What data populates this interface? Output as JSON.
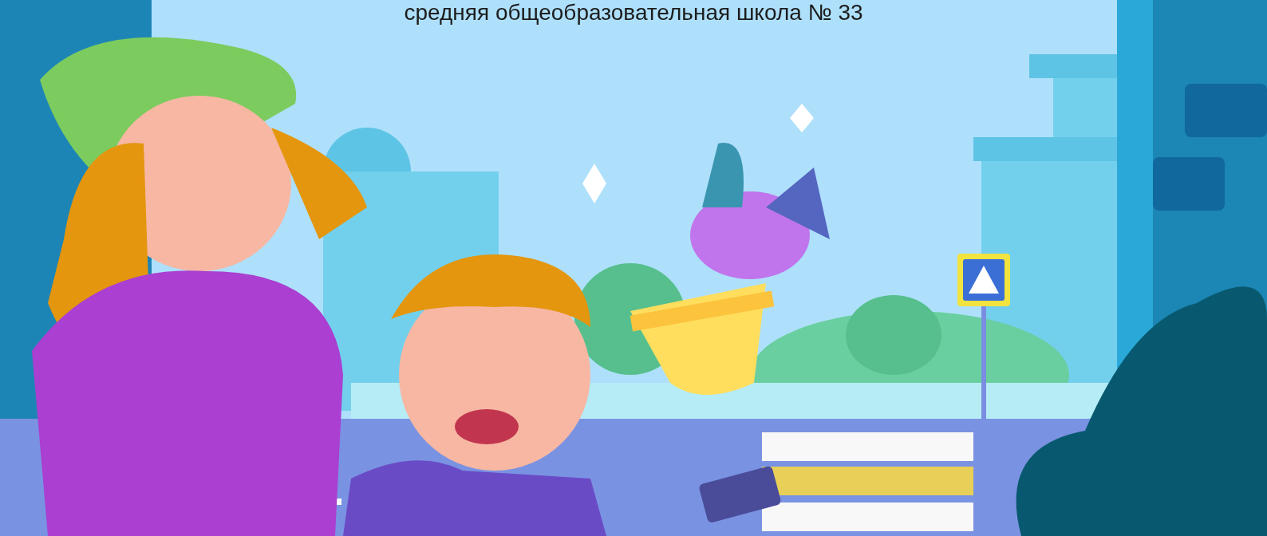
{
  "banner": {
    "title": "средняя общеобразовательная школа № 33"
  }
}
